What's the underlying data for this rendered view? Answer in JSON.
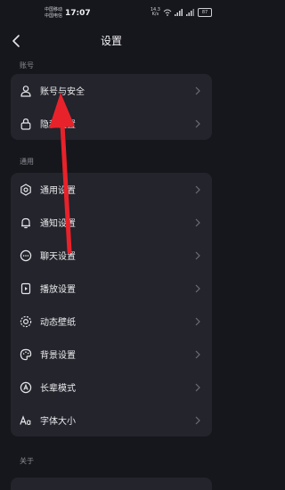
{
  "status_bar": {
    "carrier_1": "中国移动",
    "carrier_2": "中国电信",
    "time": "17:07",
    "speed": "14.3",
    "speed_unit": "K/s",
    "battery": "87"
  },
  "header": {
    "title": "设置"
  },
  "sections": [
    {
      "label": "账号",
      "items": [
        {
          "label": "账号与安全",
          "icon": "person-icon"
        },
        {
          "label": "隐私设置",
          "icon": "lock-icon"
        }
      ]
    },
    {
      "label": "通用",
      "items": [
        {
          "label": "通用设置",
          "icon": "gear-icon"
        },
        {
          "label": "通知设置",
          "icon": "bell-icon"
        },
        {
          "label": "聊天设置",
          "icon": "chat-bubble-icon"
        },
        {
          "label": "播放设置",
          "icon": "play-icon"
        },
        {
          "label": "动态壁纸",
          "icon": "wallpaper-icon"
        },
        {
          "label": "背景设置",
          "icon": "palette-icon"
        },
        {
          "label": "长辈模式",
          "icon": "elder-mode-icon"
        },
        {
          "label": "字体大小",
          "icon": "font-size-icon"
        }
      ]
    },
    {
      "label": "关于",
      "items": []
    }
  ],
  "annotation": {
    "color": "#e8222a"
  },
  "colors": {
    "background": "#16171d",
    "card": "#23242c",
    "text": "#ececef",
    "muted": "#8c8d95"
  }
}
